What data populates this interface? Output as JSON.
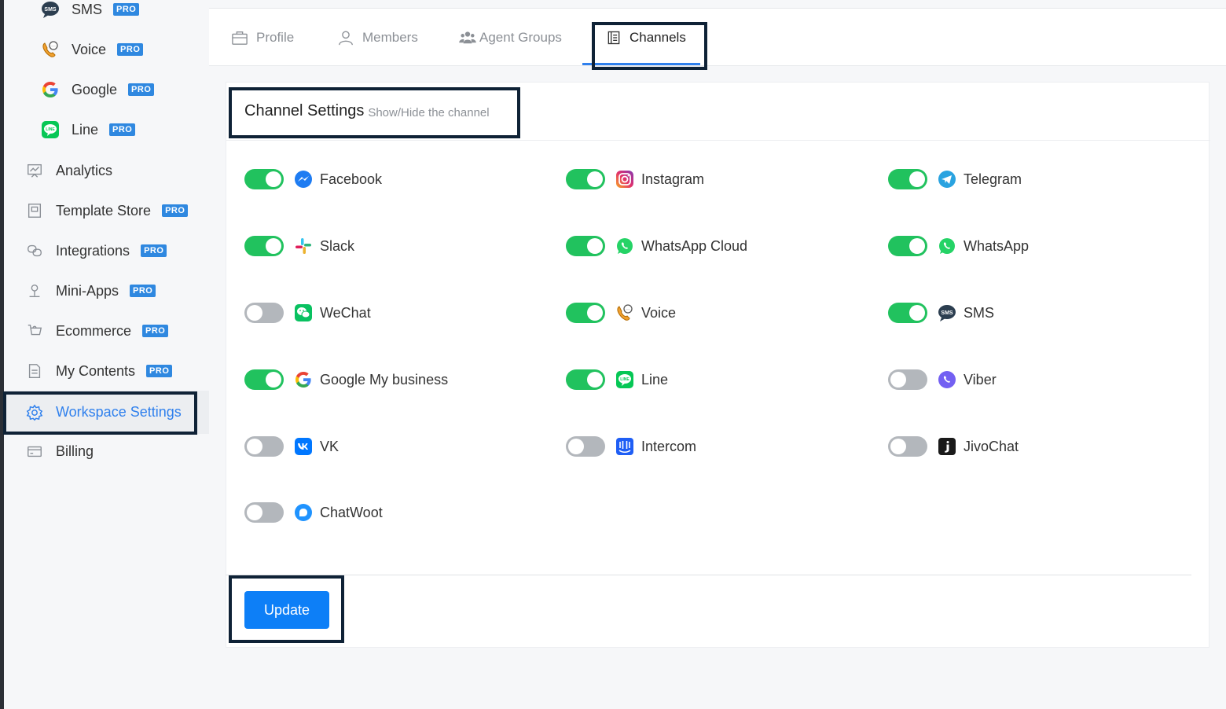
{
  "sidebar": {
    "items": [
      {
        "label": "SMS",
        "pro": "PRO",
        "icon": "sms-icon"
      },
      {
        "label": "Voice",
        "pro": "PRO",
        "icon": "voice-icon"
      },
      {
        "label": "Google",
        "pro": "PRO",
        "icon": "google-icon"
      },
      {
        "label": "Line",
        "pro": "PRO",
        "icon": "line-icon"
      },
      {
        "label": "Analytics",
        "icon": "analytics-icon"
      },
      {
        "label": "Template Store",
        "pro": "PRO",
        "icon": "template-store-icon"
      },
      {
        "label": "Integrations",
        "pro": "PRO",
        "icon": "integrations-icon"
      },
      {
        "label": "Mini-Apps",
        "pro": "PRO",
        "icon": "mini-apps-icon"
      },
      {
        "label": "Ecommerce",
        "pro": "PRO",
        "icon": "cart-icon"
      },
      {
        "label": "My Contents",
        "pro": "PRO",
        "icon": "document-icon"
      },
      {
        "label": "Workspace Settings",
        "icon": "gear-icon"
      },
      {
        "label": "Billing",
        "icon": "credit-card-icon"
      }
    ]
  },
  "tabs": [
    {
      "label": "Profile",
      "icon": "briefcase-icon"
    },
    {
      "label": "Members",
      "icon": "user-icon"
    },
    {
      "label": "Agent Groups",
      "icon": "users-icon"
    },
    {
      "label": "Channels",
      "icon": "list-icon"
    }
  ],
  "card": {
    "title": "Channel Settings",
    "subtitle": "Show/Hide the channel"
  },
  "channels": [
    {
      "name": "Facebook",
      "on": true,
      "icon": "messenger-icon"
    },
    {
      "name": "Instagram",
      "on": true,
      "icon": "instagram-icon"
    },
    {
      "name": "Telegram",
      "on": true,
      "icon": "telegram-icon"
    },
    {
      "name": "Slack",
      "on": true,
      "icon": "slack-icon"
    },
    {
      "name": "WhatsApp Cloud",
      "on": true,
      "icon": "whatsapp-icon"
    },
    {
      "name": "WhatsApp",
      "on": true,
      "icon": "whatsapp-icon"
    },
    {
      "name": "WeChat",
      "on": false,
      "icon": "wechat-icon"
    },
    {
      "name": "Voice",
      "on": true,
      "icon": "voice-icon"
    },
    {
      "name": "SMS",
      "on": true,
      "icon": "sms-icon"
    },
    {
      "name": "Google My business",
      "on": true,
      "icon": "google-icon"
    },
    {
      "name": "Line",
      "on": true,
      "icon": "line-icon"
    },
    {
      "name": "Viber",
      "on": false,
      "icon": "viber-icon"
    },
    {
      "name": "VK",
      "on": false,
      "icon": "vk-icon"
    },
    {
      "name": "Intercom",
      "on": false,
      "icon": "intercom-icon"
    },
    {
      "name": "JivoChat",
      "on": false,
      "icon": "jivochat-icon"
    },
    {
      "name": "ChatWoot",
      "on": false,
      "icon": "chatwoot-icon"
    }
  ],
  "update_label": "Update",
  "colors": {
    "accent": "#2f80ed",
    "toggle_on": "#21c25e",
    "toggle_off": "#b3b7bc",
    "button": "#0d7ff7",
    "highlight_box": "#0f2236"
  }
}
